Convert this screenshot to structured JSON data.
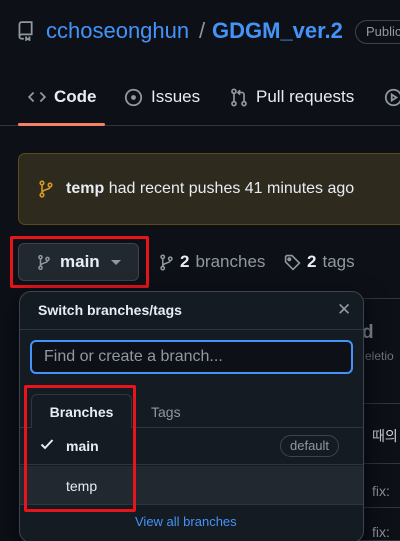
{
  "repo": {
    "owner": "cchoseonghun",
    "separator": "/",
    "name": "GDGM_ver.2",
    "visibility": "Public"
  },
  "tabs": [
    {
      "label": "Code",
      "icon": "code-icon"
    },
    {
      "label": "Issues",
      "icon": "issue-opened-icon"
    },
    {
      "label": "Pull requests",
      "icon": "git-pull-request-icon"
    }
  ],
  "push_banner": {
    "branch": "temp",
    "message": "had recent pushes 41 minutes ago"
  },
  "branch_button": {
    "label": "main"
  },
  "branches_link": {
    "count": "2",
    "label": "branches"
  },
  "tags_link": {
    "count": "2",
    "label": "tags"
  },
  "dropdown": {
    "title": "Switch branches/tags",
    "close": "✕",
    "search_placeholder": "Find or create a branch...",
    "tab_branches": "Branches",
    "tab_tags": "Tags",
    "branches": [
      {
        "name": "main",
        "selected": true,
        "badge": "default"
      },
      {
        "name": "temp",
        "selected": false,
        "badge": ""
      }
    ],
    "view_all": "View all branches"
  },
  "background": {
    "header_fragment": "d",
    "sub_fragment": "eletio",
    "row_text_1": "때의",
    "row_text_2": "fix: ",
    "row_text_3": "fix: "
  },
  "colors": {
    "accent": "#4493f8",
    "tab_underline": "#f78166",
    "annotation_red": "#e8141c",
    "banner_bg": "#2e2a1d"
  }
}
